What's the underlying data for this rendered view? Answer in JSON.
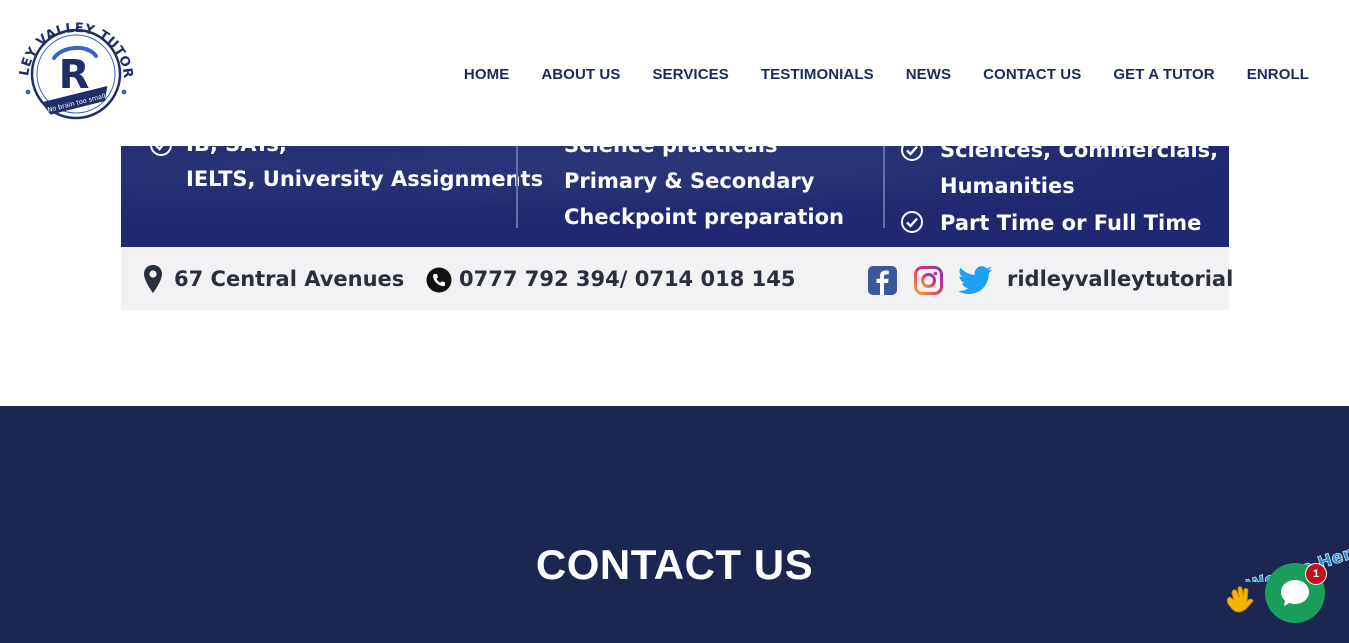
{
  "site": {
    "logo": {
      "ring_text": "RIDLEY VALLEY TUTORIAL",
      "monogram": "R",
      "tagline": "No brain too small"
    }
  },
  "nav": {
    "items": [
      {
        "label": "HOME"
      },
      {
        "label": "ABOUT US"
      },
      {
        "label": "SERVICES"
      },
      {
        "label": "TESTIMONIALS"
      },
      {
        "label": "NEWS"
      },
      {
        "label": "CONTACT US"
      },
      {
        "label": "GET A TUTOR"
      },
      {
        "label": "ENROLL"
      }
    ]
  },
  "banner": {
    "col1": {
      "line1": "IB, SATs,",
      "line2": "IELTS, University Assignments"
    },
    "col2": {
      "line1": "Science practicals",
      "line2": "Primary & Secondary",
      "line3": "Checkpoint preparation"
    },
    "col3": {
      "line1": "Sciences, Commercials,",
      "line2": "Humanities",
      "line3": "Part Time or Full Time"
    },
    "address": "67 Central Avenues",
    "phones": "0777 792 394/ 0714 018 145",
    "social_handle": "ridleyvalleytutorial"
  },
  "contact": {
    "title": "CONTACT US"
  },
  "chat": {
    "banner_text": "We Are Here!",
    "badge_count": "1"
  },
  "colors": {
    "nav_text": "#1b2a5a",
    "banner_navy": "#1f2870",
    "contact_bg": "#1b2750",
    "chat_green": "#1a9e5a",
    "badge_red": "#c0111f"
  }
}
